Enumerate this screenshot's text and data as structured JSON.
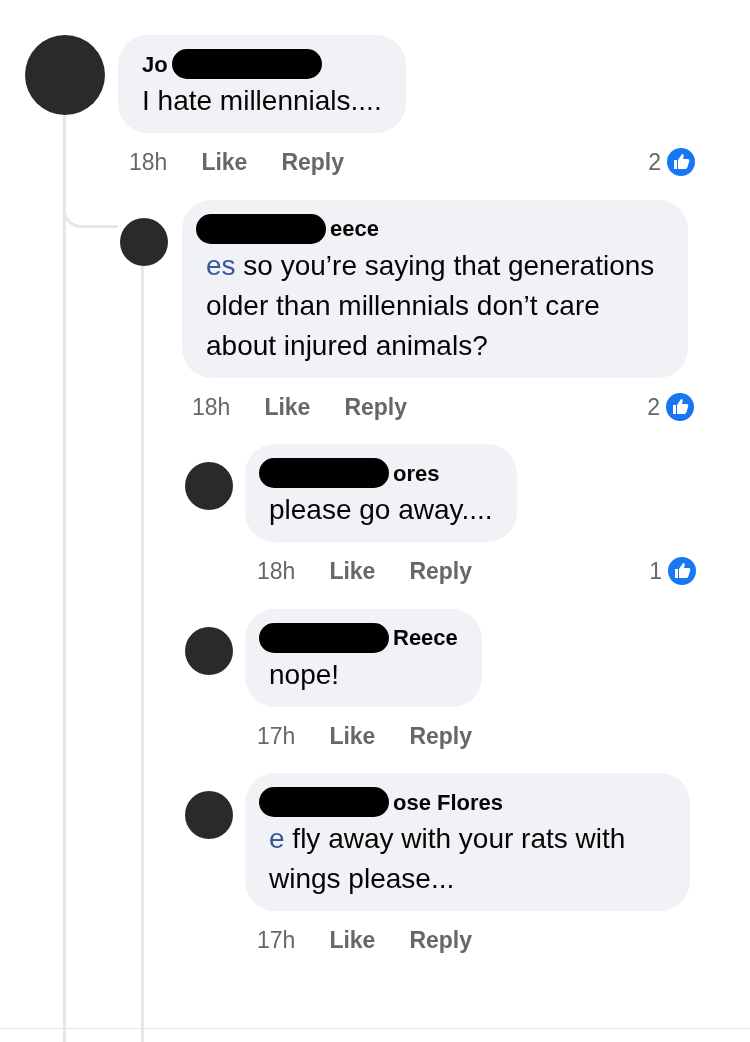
{
  "comments": [
    {
      "author": "Jo",
      "text": "I hate millennials....",
      "redacted": true,
      "time": "18h",
      "like": "Like",
      "reply": "Reply",
      "reactions": "2",
      "children": [
        {
          "author": "eece",
          "mention": "es",
          "text": " so you’re saying that generations older than millennials don’t care about injured animals?",
          "redacted": true,
          "time": "18h",
          "like": "Like",
          "reply": "Reply",
          "reactions": "2",
          "children": [
            {
              "author": "ores",
              "text": "please go away....",
              "redacted": true,
              "time": "18h",
              "like": "Like",
              "reply": "Reply",
              "reactions": "1"
            },
            {
              "author": "Reece",
              "text": "nope!",
              "redacted": true,
              "time": "17h",
              "like": "Like",
              "reply": "Reply"
            },
            {
              "author": "ose Flores",
              "mention": "e",
              "text": " fly away with your rats with wings please...",
              "redacted": true,
              "time": "17h",
              "like": "Like",
              "reply": "Reply"
            }
          ]
        }
      ]
    }
  ]
}
